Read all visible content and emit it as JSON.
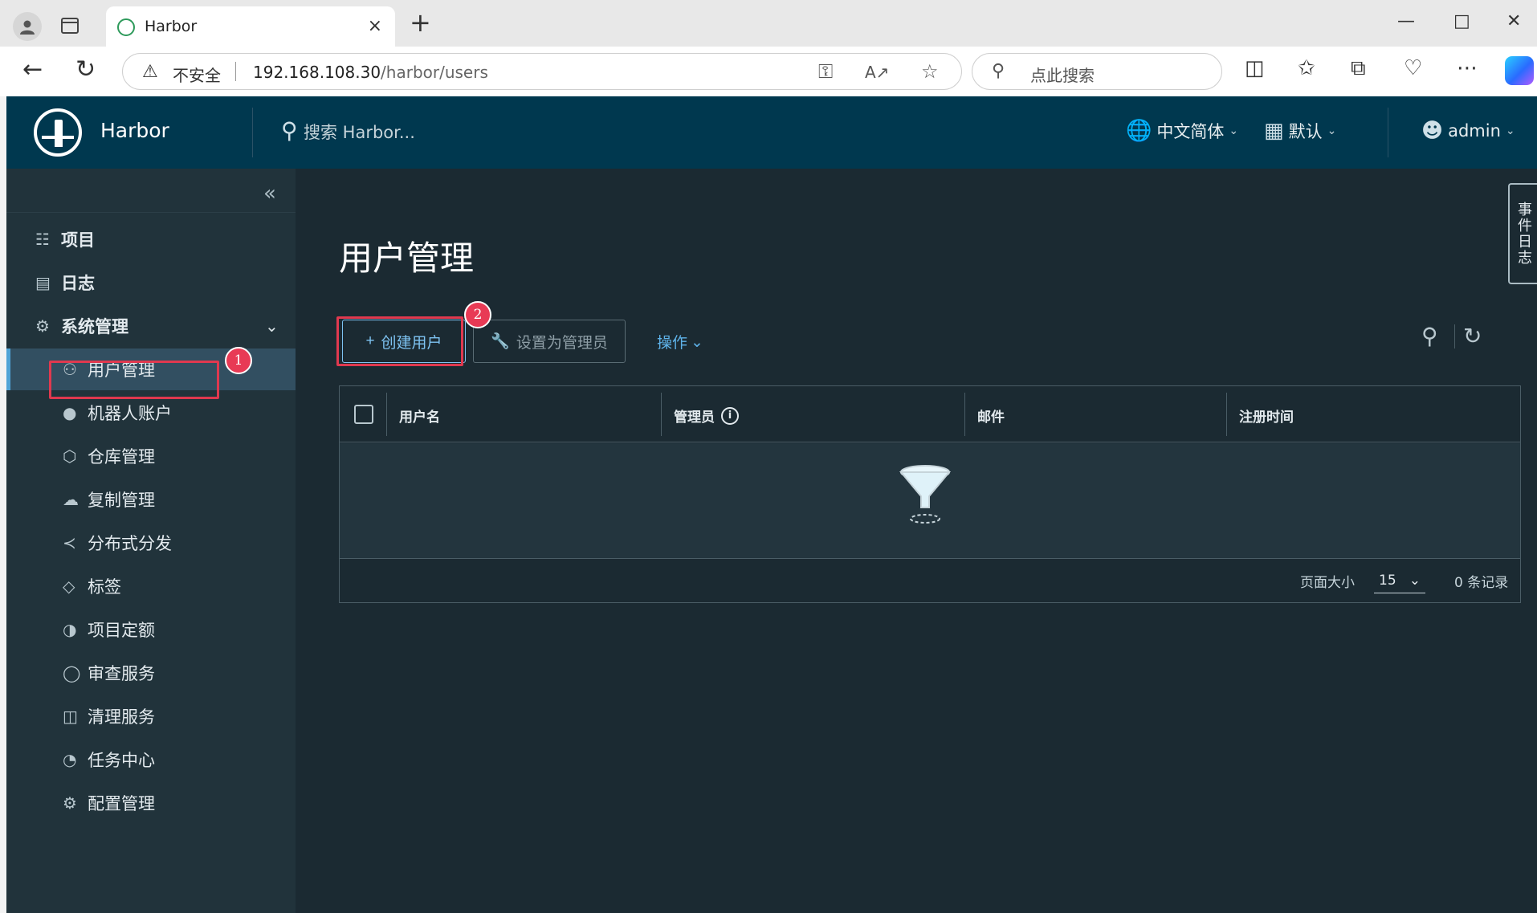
{
  "browser": {
    "tab_title": "Harbor",
    "close_tab": "×",
    "new_tab": "+",
    "insecure_label": "不安全",
    "url_host": "192.168.108.30",
    "url_path": "/harbor/users",
    "search_placeholder": "点此搜索"
  },
  "header": {
    "brand": "Harbor",
    "search_placeholder": "搜索 Harbor...",
    "language": "中文简体",
    "theme": "默认",
    "user": "admin"
  },
  "sidebar": {
    "items": [
      {
        "label": "项目",
        "icon": "projects-icon"
      },
      {
        "label": "日志",
        "icon": "logs-icon"
      },
      {
        "label": "系统管理",
        "icon": "admin-icon"
      },
      {
        "label": "用户管理",
        "icon": "users-icon"
      },
      {
        "label": "机器人账户",
        "icon": "robot-icon"
      },
      {
        "label": "仓库管理",
        "icon": "registry-icon"
      },
      {
        "label": "复制管理",
        "icon": "replication-icon"
      },
      {
        "label": "分布式分发",
        "icon": "distribution-icon"
      },
      {
        "label": "标签",
        "icon": "tag-icon"
      },
      {
        "label": "项目定额",
        "icon": "quota-icon"
      },
      {
        "label": "审查服务",
        "icon": "shield-icon"
      },
      {
        "label": "清理服务",
        "icon": "trash-icon"
      },
      {
        "label": "任务中心",
        "icon": "dashboard-icon"
      },
      {
        "label": "配置管理",
        "icon": "gear-icon"
      }
    ]
  },
  "main": {
    "title": "用户管理",
    "create_user": "创建用户",
    "set_admin": "设置为管理员",
    "actions": "操作",
    "columns": [
      "用户名",
      "管理员",
      "邮件",
      "注册时间"
    ],
    "page_size_label": "页面大小",
    "page_size": "15",
    "record_count": "0 条记录"
  },
  "event_log": "事件日志",
  "annotations": {
    "badge1": "1",
    "badge2": "2"
  },
  "colors": {
    "header_bg": "#00384f",
    "sidebar_bg": "#21333b",
    "content_bg": "#1b2a32",
    "accent": "#7ec3f2",
    "highlight": "#e0394f"
  }
}
